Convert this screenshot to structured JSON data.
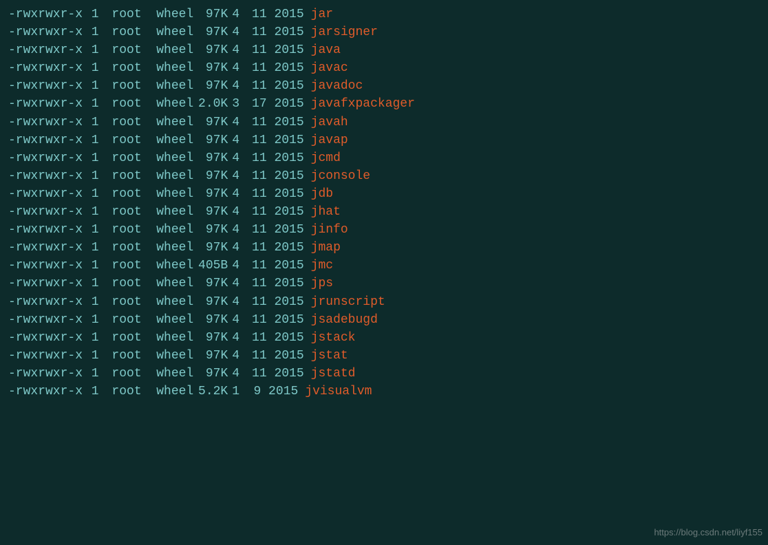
{
  "terminal": {
    "bg_color": "#0d2b2b",
    "text_color": "#7ec8c8",
    "filename_color": "#e05c2a",
    "lines": [
      {
        "perm": "-rwxrwxr-x",
        "links": "1",
        "owner": "root",
        "group": "wheel",
        "size": "97K",
        "month": "4",
        "day": "11",
        "year": "2015",
        "filename": "jar"
      },
      {
        "perm": "-rwxrwxr-x",
        "links": "1",
        "owner": "root",
        "group": "wheel",
        "size": "97K",
        "month": "4",
        "day": "11",
        "year": "2015",
        "filename": "jarsigner"
      },
      {
        "perm": "-rwxrwxr-x",
        "links": "1",
        "owner": "root",
        "group": "wheel",
        "size": "97K",
        "month": "4",
        "day": "11",
        "year": "2015",
        "filename": "java"
      },
      {
        "perm": "-rwxrwxr-x",
        "links": "1",
        "owner": "root",
        "group": "wheel",
        "size": "97K",
        "month": "4",
        "day": "11",
        "year": "2015",
        "filename": "javac"
      },
      {
        "perm": "-rwxrwxr-x",
        "links": "1",
        "owner": "root",
        "group": "wheel",
        "size": "97K",
        "month": "4",
        "day": "11",
        "year": "2015",
        "filename": "javadoc"
      },
      {
        "perm": "-rwxrwxr-x",
        "links": "1",
        "owner": "root",
        "group": "wheel",
        "size": "2.0K",
        "month": "3",
        "day": "17",
        "year": "2015",
        "filename": "javafxpackager"
      },
      {
        "perm": "-rwxrwxr-x",
        "links": "1",
        "owner": "root",
        "group": "wheel",
        "size": "97K",
        "month": "4",
        "day": "11",
        "year": "2015",
        "filename": "javah"
      },
      {
        "perm": "-rwxrwxr-x",
        "links": "1",
        "owner": "root",
        "group": "wheel",
        "size": "97K",
        "month": "4",
        "day": "11",
        "year": "2015",
        "filename": "javap"
      },
      {
        "perm": "-rwxrwxr-x",
        "links": "1",
        "owner": "root",
        "group": "wheel",
        "size": "97K",
        "month": "4",
        "day": "11",
        "year": "2015",
        "filename": "jcmd"
      },
      {
        "perm": "-rwxrwxr-x",
        "links": "1",
        "owner": "root",
        "group": "wheel",
        "size": "97K",
        "month": "4",
        "day": "11",
        "year": "2015",
        "filename": "jconsole"
      },
      {
        "perm": "-rwxrwxr-x",
        "links": "1",
        "owner": "root",
        "group": "wheel",
        "size": "97K",
        "month": "4",
        "day": "11",
        "year": "2015",
        "filename": "jdb"
      },
      {
        "perm": "-rwxrwxr-x",
        "links": "1",
        "owner": "root",
        "group": "wheel",
        "size": "97K",
        "month": "4",
        "day": "11",
        "year": "2015",
        "filename": "jhat"
      },
      {
        "perm": "-rwxrwxr-x",
        "links": "1",
        "owner": "root",
        "group": "wheel",
        "size": "97K",
        "month": "4",
        "day": "11",
        "year": "2015",
        "filename": "jinfo"
      },
      {
        "perm": "-rwxrwxr-x",
        "links": "1",
        "owner": "root",
        "group": "wheel",
        "size": "97K",
        "month": "4",
        "day": "11",
        "year": "2015",
        "filename": "jmap"
      },
      {
        "perm": "-rwxrwxr-x",
        "links": "1",
        "owner": "root",
        "group": "wheel",
        "size": "405B",
        "month": "4",
        "day": "11",
        "year": "2015",
        "filename": "jmc"
      },
      {
        "perm": "-rwxrwxr-x",
        "links": "1",
        "owner": "root",
        "group": "wheel",
        "size": "97K",
        "month": "4",
        "day": "11",
        "year": "2015",
        "filename": "jps"
      },
      {
        "perm": "-rwxrwxr-x",
        "links": "1",
        "owner": "root",
        "group": "wheel",
        "size": "97K",
        "month": "4",
        "day": "11",
        "year": "2015",
        "filename": "jrunscript"
      },
      {
        "perm": "-rwxrwxr-x",
        "links": "1",
        "owner": "root",
        "group": "wheel",
        "size": "97K",
        "month": "4",
        "day": "11",
        "year": "2015",
        "filename": "jsadebugd"
      },
      {
        "perm": "-rwxrwxr-x",
        "links": "1",
        "owner": "root",
        "group": "wheel",
        "size": "97K",
        "month": "4",
        "day": "11",
        "year": "2015",
        "filename": "jstack"
      },
      {
        "perm": "-rwxrwxr-x",
        "links": "1",
        "owner": "root",
        "group": "wheel",
        "size": "97K",
        "month": "4",
        "day": "11",
        "year": "2015",
        "filename": "jstat"
      },
      {
        "perm": "-rwxrwxr-x",
        "links": "1",
        "owner": "root",
        "group": "wheel",
        "size": "97K",
        "month": "4",
        "day": "11",
        "year": "2015",
        "filename": "jstatd"
      },
      {
        "perm": "-rwxrwxr-x",
        "links": "1",
        "owner": "root",
        "group": "wheel",
        "size": "5.2K",
        "month": "1",
        "day": "9",
        "year": "2015",
        "filename": "jvisualvm"
      }
    ],
    "watermark": "https://blog.csdn.net/liyf155"
  }
}
